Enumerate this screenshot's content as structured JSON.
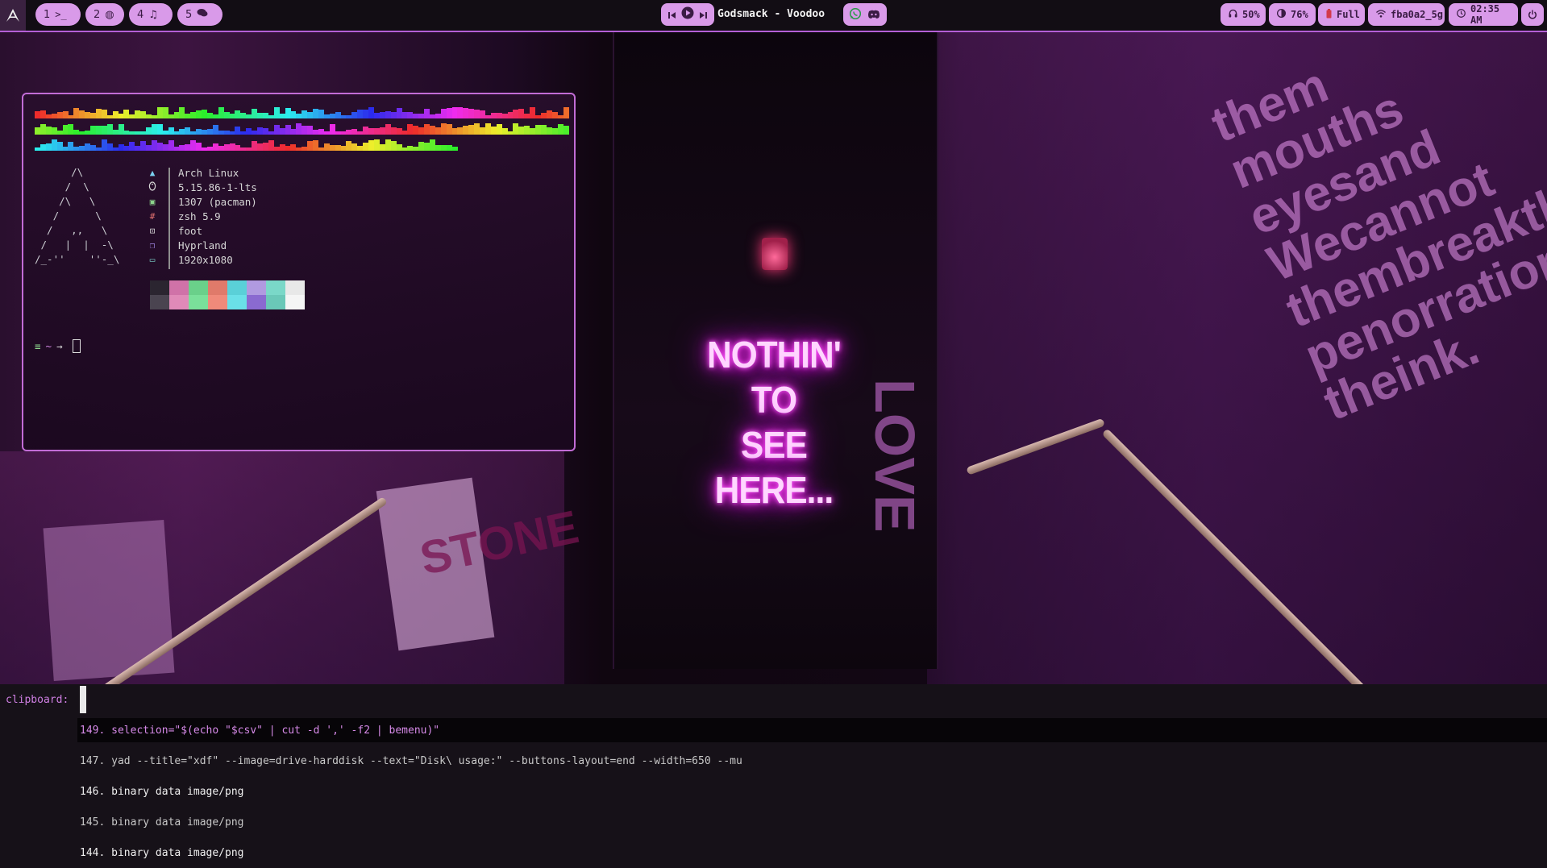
{
  "colors": {
    "accent": "#d99ae9",
    "bar_bg": "#120d14",
    "border": "#b45fd6",
    "neon": "#ff5cff"
  },
  "topbar": {
    "logo_icon": "arch-logo-icon",
    "workspaces": [
      {
        "num": "1",
        "icon": "terminal-icon",
        "glyph": ">_"
      },
      {
        "num": "2",
        "icon": "globe-icon",
        "glyph": "◍"
      },
      {
        "num": "4",
        "icon": "music-icon",
        "glyph": "♫"
      },
      {
        "num": "5",
        "icon": "chat-icon",
        "glyph": "💬"
      }
    ],
    "media": {
      "title": "Godsmack - Voodoo",
      "controls": [
        "previous-icon",
        "play-icon",
        "next-icon"
      ]
    },
    "tray_icons": [
      "whatsapp-icon",
      "discord-icon"
    ],
    "status": {
      "volume": "50%",
      "brightness": "76%",
      "battery": "Full",
      "wifi": "fba0a2_5g",
      "clock": "02:35 AM"
    },
    "power_icon": "power-icon"
  },
  "wallpaper": {
    "neon_line1": "NOTHIN' TO",
    "neon_line2": "SEE HERE...",
    "graffiti": [
      "them",
      "mouths",
      "eyesand",
      "Wecannot",
      "thembreakthe",
      "penorration",
      "theink."
    ],
    "side_text": "LOVE",
    "poster_text": "STONE"
  },
  "terminal": {
    "ascii_logo": "      /\\\n     /  \\\n    /\\   \\\n   /      \\\n  /   ,,   \\\n /   |  |  -\\\n/_-''    ''-_\\",
    "info": [
      {
        "icon": "arch-icon",
        "glyph": "▲",
        "color": "#7ad0f0",
        "value": "Arch Linux"
      },
      {
        "icon": "linux-tux-icon",
        "glyph": "🐧",
        "color": "#d8d8d8",
        "value": "5.15.86-1-lts"
      },
      {
        "icon": "package-icon",
        "glyph": "▣",
        "color": "#8bd38b",
        "value": "1307 (pacman)"
      },
      {
        "icon": "shell-hash-icon",
        "glyph": "#",
        "color": "#e07070",
        "value": "zsh 5.9"
      },
      {
        "icon": "terminal-small-icon",
        "glyph": "⊡",
        "color": "#d8d8d8",
        "value": "foot"
      },
      {
        "icon": "windows-icon",
        "glyph": "❐",
        "color": "#a58ae8",
        "value": "Hyprland"
      },
      {
        "icon": "monitor-icon",
        "glyph": "▭",
        "color": "#7ad0c8",
        "value": "1920x1080"
      }
    ],
    "swatches_top": [
      "#2b2530",
      "#d072a8",
      "#6ad08a",
      "#e07a6a",
      "#5ad0d8",
      "#b09ae0",
      "#7ad8c8",
      "#e8e8e8"
    ],
    "swatches_bottom": [
      "#4a4450",
      "#e08ab8",
      "#7ae09a",
      "#f08a7a",
      "#6ae0e8",
      "#8a6ad0",
      "#6ac8b8",
      "#f5f5f5"
    ],
    "prompt_symbol": "≡",
    "prompt_path": "~",
    "prompt_arrow": "→"
  },
  "clipboard": {
    "prompt": "clipboard:",
    "items": [
      "149. selection=\"$(echo \"$csv\" | cut -d ',' -f2 | bemenu)\"",
      "147. yad --title=\"xdf\" --image=drive-harddisk --text=\"Disk\\ usage:\" --buttons-layout=end --width=650 --mu",
      "146. binary data image/png",
      "145. binary data image/png",
      "144. binary data image/png"
    ]
  }
}
